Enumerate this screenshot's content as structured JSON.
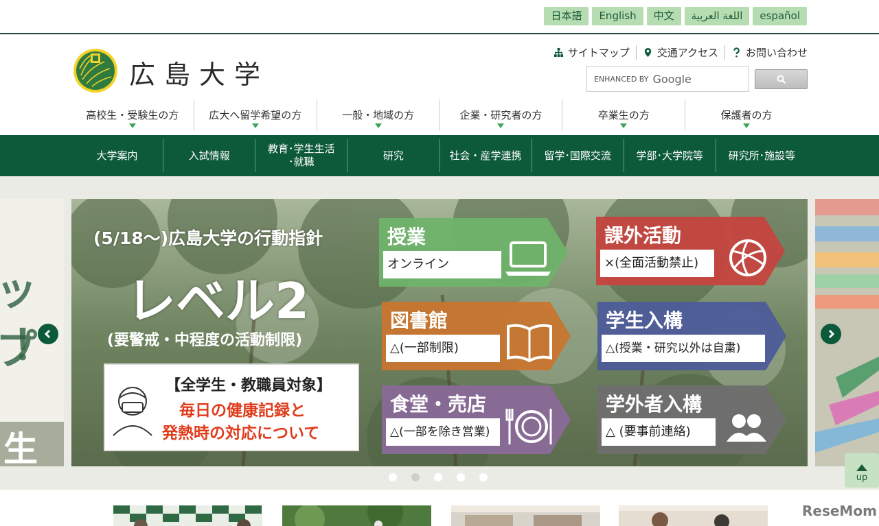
{
  "languages": [
    {
      "label": "日本語",
      "active": true
    },
    {
      "label": "English",
      "active": false
    },
    {
      "label": "中文",
      "active": false
    },
    {
      "label": "اللغة العربية",
      "active": false
    },
    {
      "label": "español",
      "active": false
    }
  ],
  "header": {
    "university_name": "広島大学",
    "utility_links": [
      {
        "label": "サイトマップ",
        "icon": "sitemap-icon"
      },
      {
        "label": "交通アクセス",
        "icon": "map-pin-icon"
      },
      {
        "label": "お問い合わせ",
        "icon": "question-icon"
      }
    ],
    "search": {
      "placeholder_prefix": "ENHANCED BY",
      "placeholder_brand": "Google",
      "button_icon": "search-icon"
    }
  },
  "audience_nav": [
    "高校生・受験生の方",
    "広大へ留学希望の方",
    "一般・地域の方",
    "企業・研究者の方",
    "卒業生の方",
    "保護者の方"
  ],
  "main_nav": [
    {
      "line1": "大学案内",
      "line2": ""
    },
    {
      "line1": "入試情報",
      "line2": ""
    },
    {
      "line1": "教育･学生生活",
      "line2": "･就職"
    },
    {
      "line1": "研究",
      "line2": ""
    },
    {
      "line1": "社会・産学連携",
      "line2": ""
    },
    {
      "line1": "留学･国際交流",
      "line2": ""
    },
    {
      "line1": "学部･大学院等",
      "line2": ""
    },
    {
      "line1": "研究所･施設等",
      "line2": ""
    }
  ],
  "carousel": {
    "headline": "(5/18〜)広島大学の行動指針",
    "level": "レベル2",
    "level_sub": "(要警戒・中程度の活動制限)",
    "notice": {
      "title": "【全学生・教職員対象】",
      "line1": "毎日の健康記録と",
      "line2": "発熱時の対応について"
    },
    "cards": [
      {
        "title": "授業",
        "status": "オンライン",
        "color": "#6fb36a",
        "icon": "laptop-icon"
      },
      {
        "title": "課外活動",
        "status": "×(全面活動禁止)",
        "color": "#c5453f",
        "icon": "volleyball-icon"
      },
      {
        "title": "図書館",
        "status": "△(一部制限)",
        "color": "#c8752f",
        "icon": "book-icon"
      },
      {
        "title": "学生入構",
        "status": "△(授業・研究以外は自粛)",
        "color": "#4e5c9a",
        "icon": "students-icon"
      },
      {
        "title": "食堂・売店",
        "status": "△(一部を除き営業)",
        "color": "#8a6a98",
        "icon": "dining-icon"
      },
      {
        "title": "学外者入構",
        "status": "△ (要事前連絡)",
        "color": "#6f6f6f",
        "icon": "people-icon"
      }
    ],
    "left_peek": {
      "line1": "ップ",
      "line2": "！",
      "band": "生"
    },
    "dots": 5,
    "active_dot": 1
  },
  "up_button": "up",
  "watermark": "ReseMom"
}
